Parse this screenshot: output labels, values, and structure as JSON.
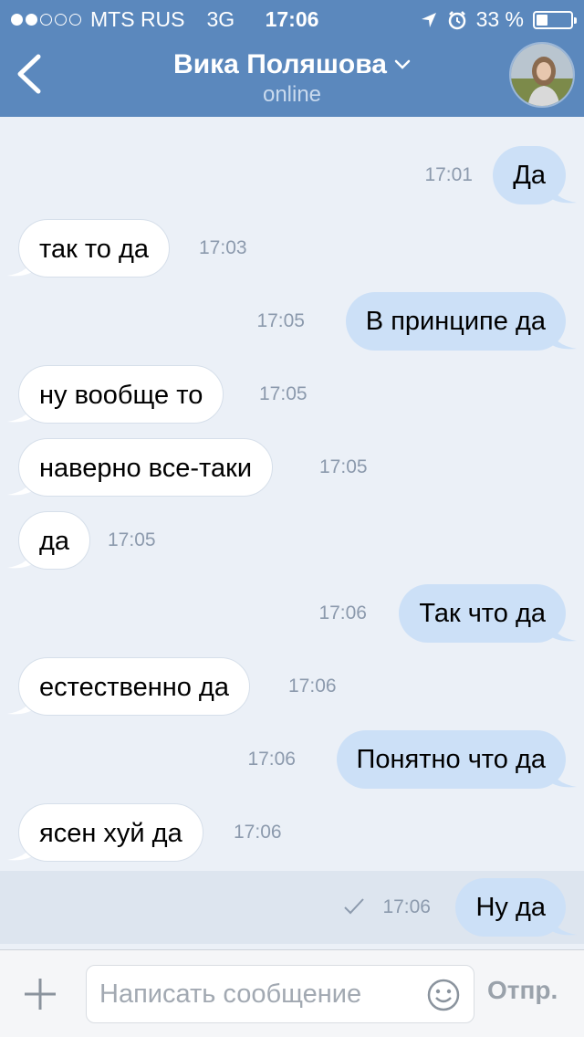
{
  "status_bar": {
    "carrier": "MTS RUS",
    "network": "3G",
    "time": "17:06",
    "battery": "33 %",
    "battery_level": 0.33
  },
  "header": {
    "title": "Вика Поляшова",
    "status": "online",
    "color": "#5b88bd"
  },
  "messages": [
    {
      "dir": "out",
      "text": "Да",
      "time": "17:01"
    },
    {
      "dir": "in",
      "text": "так то да",
      "time": "17:03"
    },
    {
      "dir": "out",
      "text": "В принципе да",
      "time": "17:05"
    },
    {
      "dir": "in",
      "text": "ну вообще то",
      "time": "17:05"
    },
    {
      "dir": "in",
      "text": "наверно все-таки",
      "time": "17:05"
    },
    {
      "dir": "in",
      "text": "да",
      "time": "17:05"
    },
    {
      "dir": "out",
      "text": "Так что да",
      "time": "17:06"
    },
    {
      "dir": "in",
      "text": "естественно да",
      "time": "17:06"
    },
    {
      "dir": "out",
      "text": "Понятно что да",
      "time": "17:06"
    },
    {
      "dir": "in",
      "text": "ясен хуй да",
      "time": "17:06"
    },
    {
      "dir": "out",
      "text": "Ну да",
      "time": "17:06",
      "sent_check": true
    }
  ],
  "composer": {
    "placeholder": "Написать сообщение",
    "send_label": "Отпр."
  },
  "icons": {
    "back": "chevron-left-icon",
    "dropdown": "chevron-down-icon",
    "plus": "plus-icon",
    "emoji": "smile-icon",
    "check": "check-icon"
  },
  "colors": {
    "incoming_bubble": "#ffffff",
    "outgoing_bubble": "#cce0f7",
    "background": "#ebf0f7"
  }
}
